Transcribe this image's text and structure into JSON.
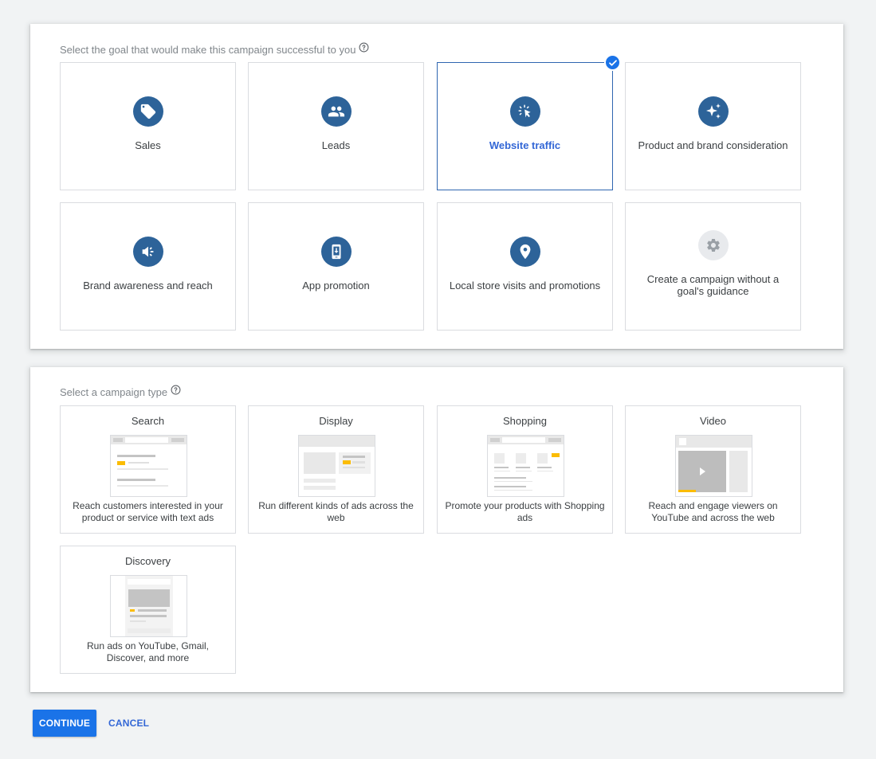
{
  "goals_section": {
    "title": "Select the goal that would make this campaign successful to you",
    "help_icon": "help-circle-icon",
    "selected": "Website traffic",
    "items": [
      {
        "label": "Sales",
        "icon": "tag-icon"
      },
      {
        "label": "Leads",
        "icon": "people-icon"
      },
      {
        "label": "Website traffic",
        "icon": "cursor-click-icon",
        "selected": true
      },
      {
        "label": "Product and brand consideration",
        "icon": "sparkle-icon"
      },
      {
        "label": "Brand awareness and reach",
        "icon": "megaphone-icon"
      },
      {
        "label": "App promotion",
        "icon": "phone-download-icon"
      },
      {
        "label": "Local store visits and promotions",
        "icon": "location-pin-icon"
      },
      {
        "label": "Create a campaign without a goal's guidance",
        "icon": "gear-icon"
      }
    ]
  },
  "types_section": {
    "title": "Select a campaign type",
    "help_icon": "help-circle-icon",
    "items": [
      {
        "title": "Search",
        "description": "Reach customers interested in your product or service with text ads"
      },
      {
        "title": "Display",
        "description": "Run different kinds of ads across the web"
      },
      {
        "title": "Shopping",
        "description": "Promote your products with Shopping ads"
      },
      {
        "title": "Video",
        "description": "Reach and engage viewers on YouTube and across the web"
      },
      {
        "title": "Discovery",
        "description": "Run ads on YouTube, Gmail, Discover, and more"
      }
    ]
  },
  "actions": {
    "continue_label": "CONTINUE",
    "cancel_label": "CANCEL"
  },
  "colors": {
    "accent": "#1a73e8",
    "icon_circle": "#2d6399",
    "selected_text": "#3367d6",
    "ad_highlight": "#fbbc04",
    "background": "#f1f3f4"
  }
}
